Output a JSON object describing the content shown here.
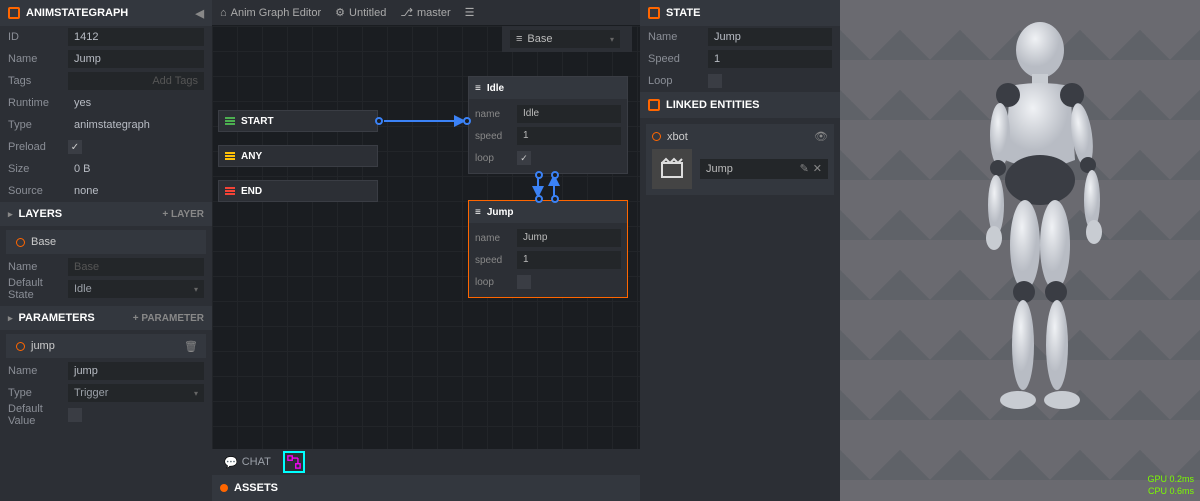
{
  "leftPanel": {
    "title": "ANIMSTATEGRAPH",
    "props": {
      "idLabel": "ID",
      "id": "1412",
      "nameLabel": "Name",
      "name": "Jump",
      "tagsLabel": "Tags",
      "tagsPlaceholder": "Add Tags",
      "runtimeLabel": "Runtime",
      "runtime": "yes",
      "typeLabel": "Type",
      "type": "animstategraph",
      "preloadLabel": "Preload",
      "sizeLabel": "Size",
      "size": "0 B",
      "sourceLabel": "Source",
      "source": "none"
    },
    "layers": {
      "title": "LAYERS",
      "addLabel": "+ LAYER",
      "item": "Base",
      "nameLabel": "Name",
      "namePlaceholder": "Base",
      "defStateLabel": "Default State",
      "defState": "Idle"
    },
    "parameters": {
      "title": "PARAMETERS",
      "addLabel": "+ PARAMETER",
      "item": "jump",
      "nameLabel": "Name",
      "name": "jump",
      "typeLabel": "Type",
      "type": "Trigger",
      "defValLabel": "Default Value"
    }
  },
  "toolbar": {
    "graphEditor": "Anim Graph Editor",
    "untitled": "Untitled",
    "branch": "master",
    "layerSelect": "Base"
  },
  "graph": {
    "start": "START",
    "any": "ANY",
    "end": "END",
    "idle": {
      "title": "Idle",
      "nameLabel": "name",
      "name": "Idle",
      "speedLabel": "speed",
      "speed": "1",
      "loopLabel": "loop"
    },
    "jump": {
      "title": "Jump",
      "nameLabel": "name",
      "name": "Jump",
      "speedLabel": "speed",
      "speed": "1",
      "loopLabel": "loop"
    }
  },
  "bottom": {
    "chat": "CHAT",
    "assets": "ASSETS"
  },
  "rightPanel": {
    "stateTitle": "STATE",
    "nameLabel": "Name",
    "name": "Jump",
    "speedLabel": "Speed",
    "speed": "1",
    "loopLabel": "Loop",
    "linkedTitle": "LINKED ENTITIES",
    "entityName": "xbot",
    "slotValue": "Jump"
  },
  "viewport": {
    "gpu": "GPU  0.2ms",
    "cpu": "CPU  0.6ms"
  }
}
